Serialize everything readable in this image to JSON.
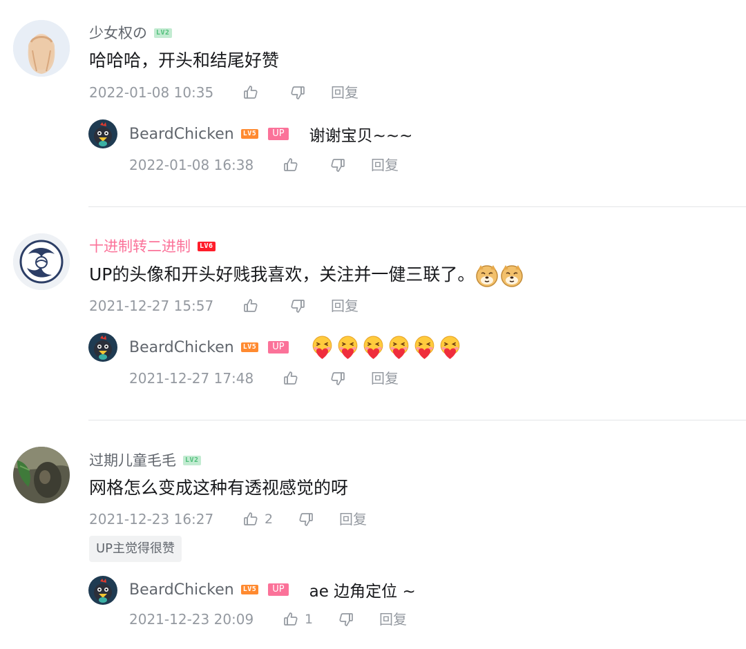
{
  "comments": [
    {
      "username": "少女权の",
      "level": "LV2",
      "content": "哈哈哈，开头和结尾好赞",
      "time": "2022-01-08 10:35",
      "like_count": "",
      "reply_label": "回复",
      "reply": {
        "username": "BeardChicken",
        "level": "LV5",
        "badge": "UP",
        "content": "谢谢宝贝~~~",
        "time": "2022-01-08 16:38",
        "like_count": "",
        "reply_label": "回复"
      }
    },
    {
      "username": "十进制转二进制",
      "level": "LV6",
      "content": "UP的头像和开头好贱我喜欢，关注并一健三联了。",
      "content_emoji": [
        "doge",
        "doge"
      ],
      "time": "2021-12-27 15:57",
      "like_count": "",
      "reply_label": "回复",
      "reply": {
        "username": "BeardChicken",
        "level": "LV5",
        "badge": "UP",
        "content_emoji": [
          "heart-hug",
          "heart-hug",
          "heart-hug",
          "heart-hug",
          "heart-hug",
          "heart-hug"
        ],
        "time": "2021-12-27 17:48",
        "like_count": "",
        "reply_label": "回复"
      }
    },
    {
      "username": "过期儿童毛毛",
      "level": "LV2",
      "content": "网格怎么变成这种有透视感觉的呀",
      "time": "2021-12-23 16:27",
      "like_count": "2",
      "reply_label": "回复",
      "tag": "UP主觉得很赞",
      "reply": {
        "username": "BeardChicken",
        "level": "LV5",
        "badge": "UP",
        "content": "ae 边角定位 ~",
        "time": "2021-12-23 20:09",
        "like_count": "1",
        "reply_label": "回复"
      }
    }
  ],
  "colors": {
    "name_gray": "#61666d",
    "name_pink": "#fb7299",
    "text": "#18191c",
    "meta": "#9499a0",
    "divider": "#e3e5e7",
    "lv2": "#c2ebd1",
    "lv5": "#ff8a30",
    "lv6": "#ff1d2a",
    "up_badge": "#fb7299"
  },
  "icons": {
    "like": "thumbs-up-icon",
    "dislike": "thumbs-down-icon"
  }
}
